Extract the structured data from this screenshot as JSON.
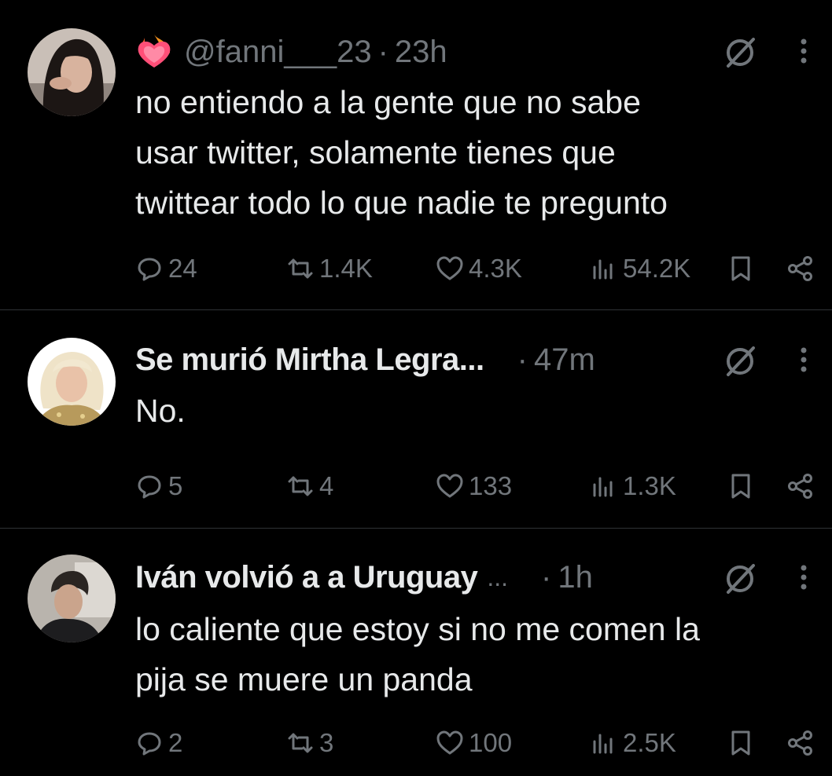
{
  "tweets": [
    {
      "display_name": "",
      "handle": "@fanni___23",
      "separator": "·",
      "time": "23h",
      "text_lines": [
        "no entiendo a la gente que no sabe",
        "usar twitter, solamente tienes que",
        "twittear todo lo que nadie te pregunto"
      ],
      "replies": "24",
      "reposts": "1.4K",
      "likes": "4.3K",
      "views": "54.2K"
    },
    {
      "display_name": "Se murió Mirtha Legra...",
      "handle": "",
      "separator": "·",
      "time": "47m",
      "text_lines": [
        "No."
      ],
      "replies": "5",
      "reposts": "4",
      "likes": "133",
      "views": "1.3K"
    },
    {
      "display_name": "Iván volvió a a Uruguay",
      "name_ellipsis": "...",
      "handle": "",
      "separator": "·",
      "time": "1h",
      "text_lines": [
        "lo caliente que estoy si no me comen la",
        "pija se muere un panda"
      ],
      "replies": "2",
      "reposts": "3",
      "likes": "100",
      "views": "2.5K"
    }
  ],
  "icons": {
    "reply": "reply-icon",
    "repost": "repost-icon",
    "like": "heart-icon",
    "views": "views-icon",
    "bookmark": "bookmark-icon",
    "share": "share-icon",
    "grok": "grok-icon",
    "more": "more-icon",
    "badge": "heart-on-fire-emoji"
  },
  "colors": {
    "background": "#000000",
    "text_primary": "#e7e9ea",
    "text_secondary": "#71767b",
    "divider": "#2f3336"
  }
}
